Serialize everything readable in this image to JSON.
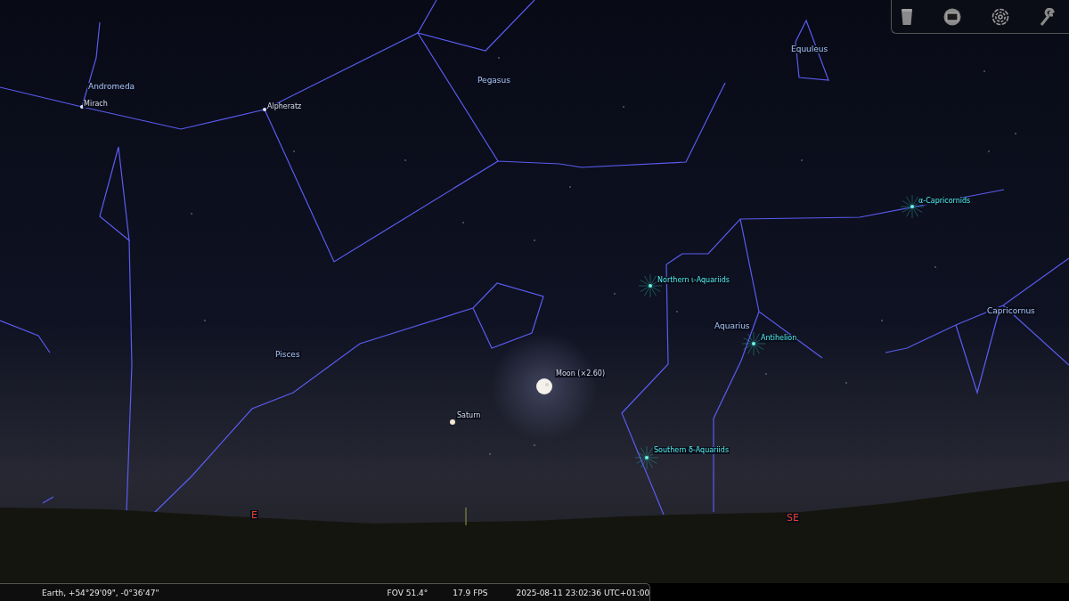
{
  "constellations": [
    {
      "name": "Andromeda"
    },
    {
      "name": "Pegasus"
    },
    {
      "name": "Equuleus"
    },
    {
      "name": "Pisces"
    },
    {
      "name": "Aquarius"
    },
    {
      "name": "Capricornus"
    }
  ],
  "stars": [
    {
      "name": "Mirach"
    },
    {
      "name": "Alpheratz"
    }
  ],
  "planets": [
    {
      "name": "Saturn"
    },
    {
      "name": "Moon (×2.60)",
      "kind": "moon"
    }
  ],
  "meteor_showers": [
    {
      "name": "α-Capricornids"
    },
    {
      "name": "Northern ι-Aquariids"
    },
    {
      "name": "Antihelion"
    },
    {
      "name": "Southern δ-Aquariids"
    }
  ],
  "cardinal_points": [
    {
      "label": "E"
    },
    {
      "label": "SE"
    }
  ],
  "status_bar": {
    "location": "Earth, +54°29'09\", -0°36'47\"",
    "fov": "FOV 51.4°",
    "fps": "17.9 FPS",
    "datetime": "2025-08-11 23:02:36 UTC+01:00"
  }
}
